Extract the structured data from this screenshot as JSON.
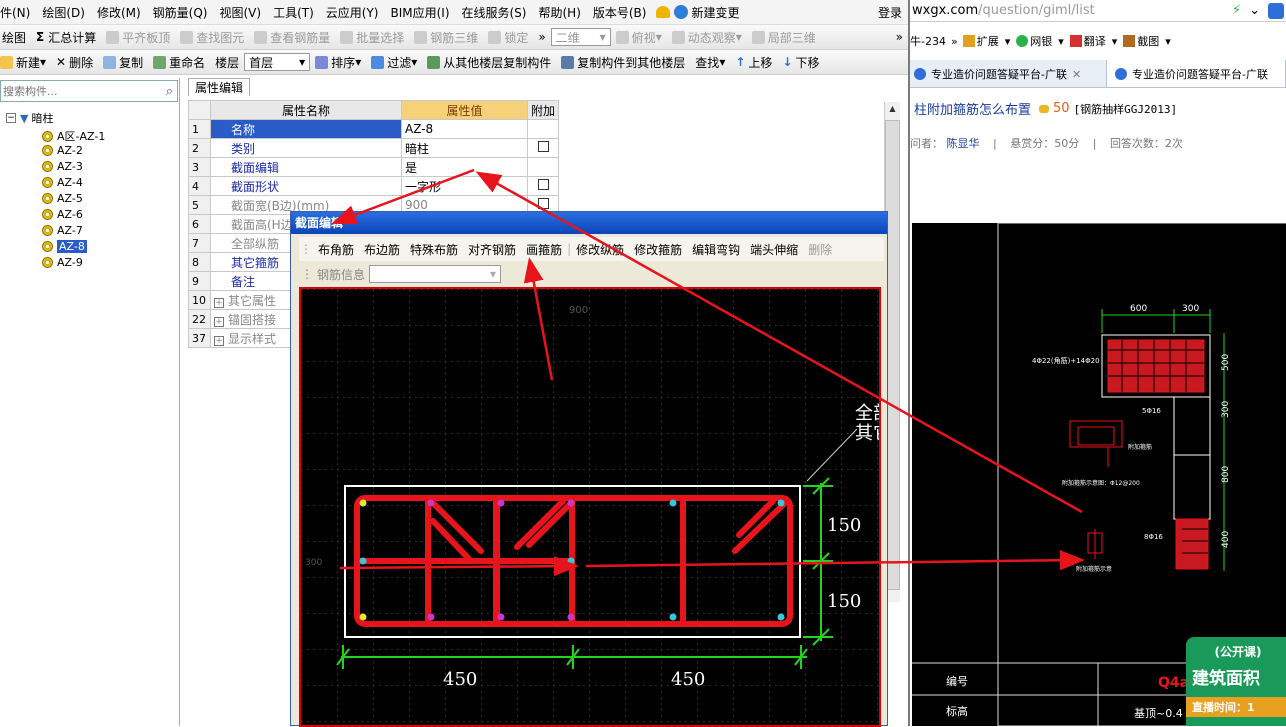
{
  "menu": {
    "items": [
      "件(N)",
      "绘图(D)",
      "修改(M)",
      "钢筋量(Q)",
      "视图(V)",
      "工具(T)",
      "云应用(Y)",
      "BIM应用(I)",
      "在线服务(S)",
      "帮助(H)",
      "版本号(B)"
    ],
    "new_change": "新建变更",
    "login": "登录"
  },
  "toolbar2": {
    "draw": "绘图",
    "sum": "汇总计算",
    "flush": "平齐板顶",
    "find": "查找图元",
    "view_qty": "查看钢筋量",
    "batch": "批量选择",
    "rebar3d": "钢筋三维",
    "lock": "锁定",
    "view2d": "二维",
    "top_view": "俯视",
    "dynamic": "动态观察",
    "local3d": "局部三维"
  },
  "toolbar3": {
    "new": "新建",
    "delete": "删除",
    "copy": "复制",
    "rename": "重命名",
    "floor_label": "楼层",
    "floor_value": "首层",
    "sort": "排序",
    "filter": "过滤",
    "copy_from": "从其他楼层复制构件",
    "copy_to": "复制构件到其他楼层",
    "search": "查找",
    "up": "上移",
    "down": "下移"
  },
  "tree": {
    "search_placeholder": "搜索构件...",
    "root": "暗柱",
    "items": [
      "A区-AZ-1",
      "AZ-2",
      "AZ-3",
      "AZ-4",
      "AZ-5",
      "AZ-6",
      "AZ-7",
      "AZ-8",
      "AZ-9"
    ],
    "selected": "AZ-8"
  },
  "props": {
    "tab": "属性编辑",
    "headers": {
      "name": "属性名称",
      "value": "属性值",
      "extra": "附加"
    },
    "rows": [
      {
        "n": "1",
        "name": "名称",
        "value": "AZ-8"
      },
      {
        "n": "2",
        "name": "类别",
        "value": "暗柱"
      },
      {
        "n": "3",
        "name": "截面编辑",
        "value": "是"
      },
      {
        "n": "4",
        "name": "截面形状",
        "value": "一字形"
      },
      {
        "n": "5",
        "name": "截面宽(B边)(mm)",
        "value": "900"
      },
      {
        "n": "6",
        "name": "截面高(H边)(mm)",
        "value": ""
      },
      {
        "n": "7",
        "name": "全部纵筋",
        "value": ""
      },
      {
        "n": "8",
        "name": "其它箍筋",
        "value": ""
      },
      {
        "n": "9",
        "name": "备注",
        "value": ""
      },
      {
        "n": "10",
        "name": "其它属性",
        "value": ""
      },
      {
        "n": "22",
        "name": "锚固搭接",
        "value": ""
      },
      {
        "n": "37",
        "name": "显示样式",
        "value": ""
      }
    ]
  },
  "dialog": {
    "title": "截面编辑",
    "tools": [
      "布角筋",
      "布边筋",
      "特殊布筋",
      "对齐钢筋",
      "画箍筋",
      "修改纵筋",
      "修改箍筋",
      "编辑弯钩",
      "端头伸缩",
      "删除"
    ],
    "rebar_info_label": "钢筋信息",
    "top_dim": "900",
    "left_dim": "300",
    "dim_w1": "450",
    "dim_w2": "450",
    "dim_h1": "150",
    "dim_h2": "150",
    "label_line1": "全部",
    "label_line2": "其它"
  },
  "browser": {
    "url_domain": "wxgx.com",
    "url_path": "/question/giml/list",
    "bar_left": "牛-234",
    "ext": "扩展",
    "bank": "网银",
    "translate": "翻译",
    "screenshot": "截图",
    "tab1": "专业造价问题答疑平台-广联",
    "tab2": "专业造价问题答疑平台-广联",
    "question": "柱附加箍筋怎么布置",
    "reward": "50",
    "tag": "[钢筋抽样GGJ2013]",
    "asker_label": "问者：",
    "asker": "陈显华",
    "bounty": "悬赏分：50分",
    "answers": "回答次数：2次",
    "cad_note1": "4Φ22(角筋)+14Φ20",
    "cad_note2": "5Φ16",
    "cad_note3": "附加箍筋",
    "cad_note4": "附加箍筋示意图：Φ12@200",
    "cad_note5": "8Φ16",
    "cad_note6": "附加箍筋示意",
    "cad_dim1": "600",
    "cad_dim2": "300",
    "cad_dim3": "500",
    "cad_dim4": "300",
    "cad_dim5": "800",
    "cad_dim6": "400",
    "table_col1": "编号",
    "table_col2": "标高",
    "table_val1": "Q4a",
    "table_val2": "基顶~0.4",
    "ad1": "(公开课)",
    "ad2": "建筑面积",
    "ad3": "直播时间：1"
  },
  "colors": {
    "rebar": "#e8141c",
    "dim": "#21d41f",
    "title_bar": "#0a44b8",
    "selected_row": "#2a5cc8",
    "header_value": "#f5d27a"
  }
}
